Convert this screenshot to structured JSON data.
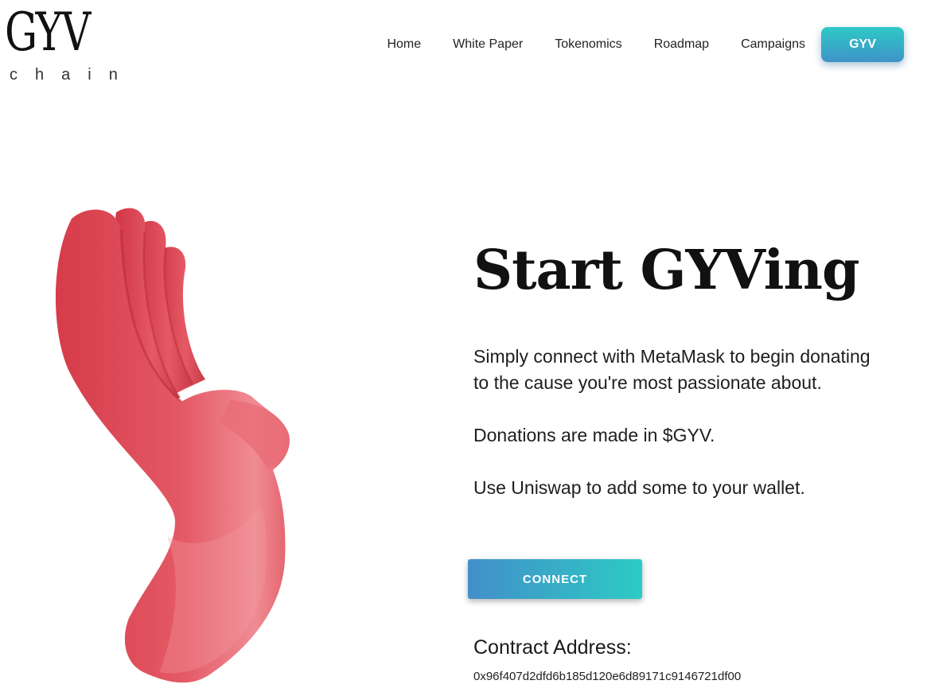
{
  "brand": {
    "logo_mark": "GYV",
    "logo_sub": "chain"
  },
  "nav": {
    "items": [
      {
        "label": "Home"
      },
      {
        "label": "White Paper"
      },
      {
        "label": "Tokenomics"
      },
      {
        "label": "Roadmap"
      },
      {
        "label": "Campaigns"
      }
    ],
    "cta_label": "GYV"
  },
  "hero": {
    "title": "Start GYVing",
    "paragraphs": [
      "Simply connect with MetaMask to begin donating to the cause you're most passionate about.",
      "Donations are made in $GYV.",
      "Use Uniswap to add some to your wallet."
    ],
    "connect_label": "CONNECT",
    "contract_label": "Contract Address:",
    "contract_address": "0x96f407d2dfd6b185d120e6d89171c9146721df00",
    "illustration_icon": "hand-illustration-icon"
  },
  "colors": {
    "accent_teal": "#2ec9c6",
    "accent_blue": "#3f93c8",
    "hand_red": "#dd4a56"
  }
}
